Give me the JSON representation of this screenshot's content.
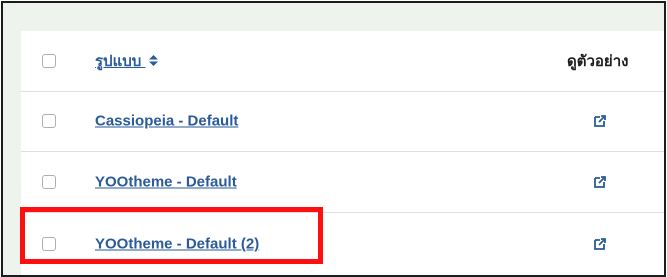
{
  "table": {
    "header": {
      "title_label": "รูปแบบ",
      "sort_icon": "sort-both-icon",
      "preview_label": "ดูตัวอย่าง"
    },
    "rows": [
      {
        "title": "Cassiopeia - Default",
        "preview_icon": "external-link-icon"
      },
      {
        "title": "YOOtheme - Default",
        "preview_icon": "external-link-icon"
      },
      {
        "title": "YOOtheme - Default (2)",
        "preview_icon": "external-link-icon"
      }
    ]
  },
  "colors": {
    "link": "#2a5a9a",
    "highlight": "#ff1010",
    "background": "#eef3ee"
  }
}
